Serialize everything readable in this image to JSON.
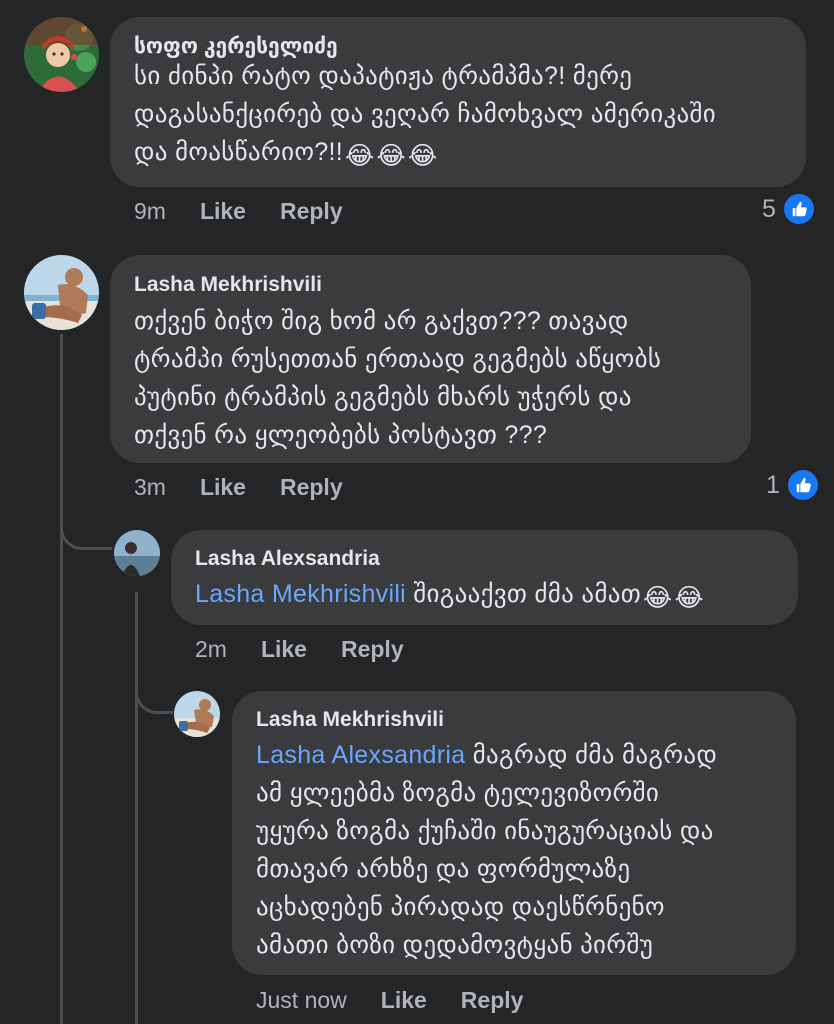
{
  "comments": [
    {
      "author": "სოფო კერესელიძე",
      "lines": [
        "სი ძინპი რატო დაპატიჟა ტრამპმა?! მერე",
        "დაგასანქცირებ და ვეღარ ჩამოხვალ ამერიკაში",
        "და მოასწარიო?!!"
      ],
      "emojis": [
        "😂",
        "😂",
        "😂"
      ],
      "time": "9m",
      "like_label": "Like",
      "reply_label": "Reply",
      "reaction_count": "5"
    },
    {
      "author": "Lasha Mekhrishvili",
      "lines": [
        "თქვენ ბიჭო შიგ ხომ არ გაქვთ??? თავად",
        "ტრამპი რუსეთთან ერთაად გეგმებს აწყობს",
        "პუტინი ტრამპის გეგმებს მხარს უჭერს და",
        "თქვენ რა ყლეობებს პოსტავთ ???"
      ],
      "time": "3m",
      "like_label": "Like",
      "reply_label": "Reply",
      "reaction_count": "1"
    },
    {
      "author": "Lasha Alexsandria",
      "mention": "Lasha Mekhrishvili",
      "text": "შიგააქვთ ძმა ამათ",
      "emojis": [
        "😂",
        "😂"
      ],
      "time": "2m",
      "like_label": "Like",
      "reply_label": "Reply"
    },
    {
      "author": "Lasha Mekhrishvili",
      "mention": "Lasha Alexsandria",
      "first_line_text": "მაგრად ძმა მაგრად",
      "lines": [
        "ამ ყლეებმა ზოგმა ტელევიზორში",
        "უყურა ზოგმა ქუჩაში ინაუგურაციას და",
        "მთავარ არხზე და ფორმულაზე",
        "აცხადებენ პირადად დაესწრნენო",
        "ამათი ბოზი დედამოვტყან პირშუ"
      ],
      "time": "Just now",
      "like_label": "Like",
      "reply_label": "Reply"
    }
  ],
  "colors": {
    "background": "#242526",
    "bubble": "#3a3b3c",
    "mention": "#6aa6ff",
    "like_badge": "#1877f2"
  }
}
